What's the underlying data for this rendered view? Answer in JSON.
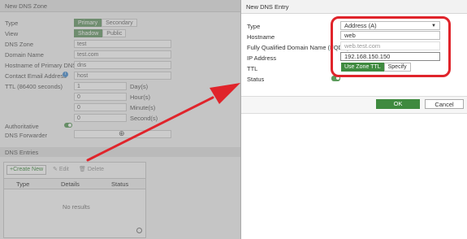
{
  "background": {
    "panel_title": "New DNS Zone",
    "type_label": "Type",
    "type_options": [
      "Primary",
      "Secondary"
    ],
    "view_label": "View",
    "view_options": [
      "Shadow",
      "Public"
    ],
    "zone_label": "DNS Zone",
    "zone_value": "test",
    "domain_label": "Domain Name",
    "domain_value": "test.com",
    "hostname_label": "Hostname of Primary DNS",
    "hostname_value": "dns",
    "email_label": "Contact Email Address",
    "email_value": "host",
    "ttl_label": "TTL (86400 seconds)",
    "ttl_rows": [
      {
        "value": "1",
        "unit": "Day(s)"
      },
      {
        "value": "0",
        "unit": "Hour(s)"
      },
      {
        "value": "0",
        "unit": "Minute(s)"
      },
      {
        "value": "0",
        "unit": "Second(s)"
      }
    ],
    "authoritative_label": "Authoritative",
    "forwarder_label": "DNS Forwarder",
    "entries_title": "DNS Entries",
    "create_new": "Create New",
    "edit": "Edit",
    "delete": "Delete",
    "columns": [
      "Type",
      "Details",
      "Status"
    ],
    "empty_text": "No results"
  },
  "modal": {
    "title": "New DNS Entry",
    "type_label": "Type",
    "type_value": "Address (A)",
    "hostname_label": "Hostname",
    "hostname_value": "web",
    "fqdn_label": "Fully Qualified Domain Name (FQDN)",
    "fqdn_value": "web.test.com",
    "ip_label": "IP Address",
    "ip_value": "192.168.150.150",
    "ttl_label": "TTL",
    "ttl_options": [
      "Use Zone TTL",
      "Specify"
    ],
    "status_label": "Status",
    "ok_label": "OK",
    "cancel_label": "Cancel"
  },
  "colors": {
    "accent_green": "#3f8a3f",
    "annotation_red": "#e0242b"
  }
}
